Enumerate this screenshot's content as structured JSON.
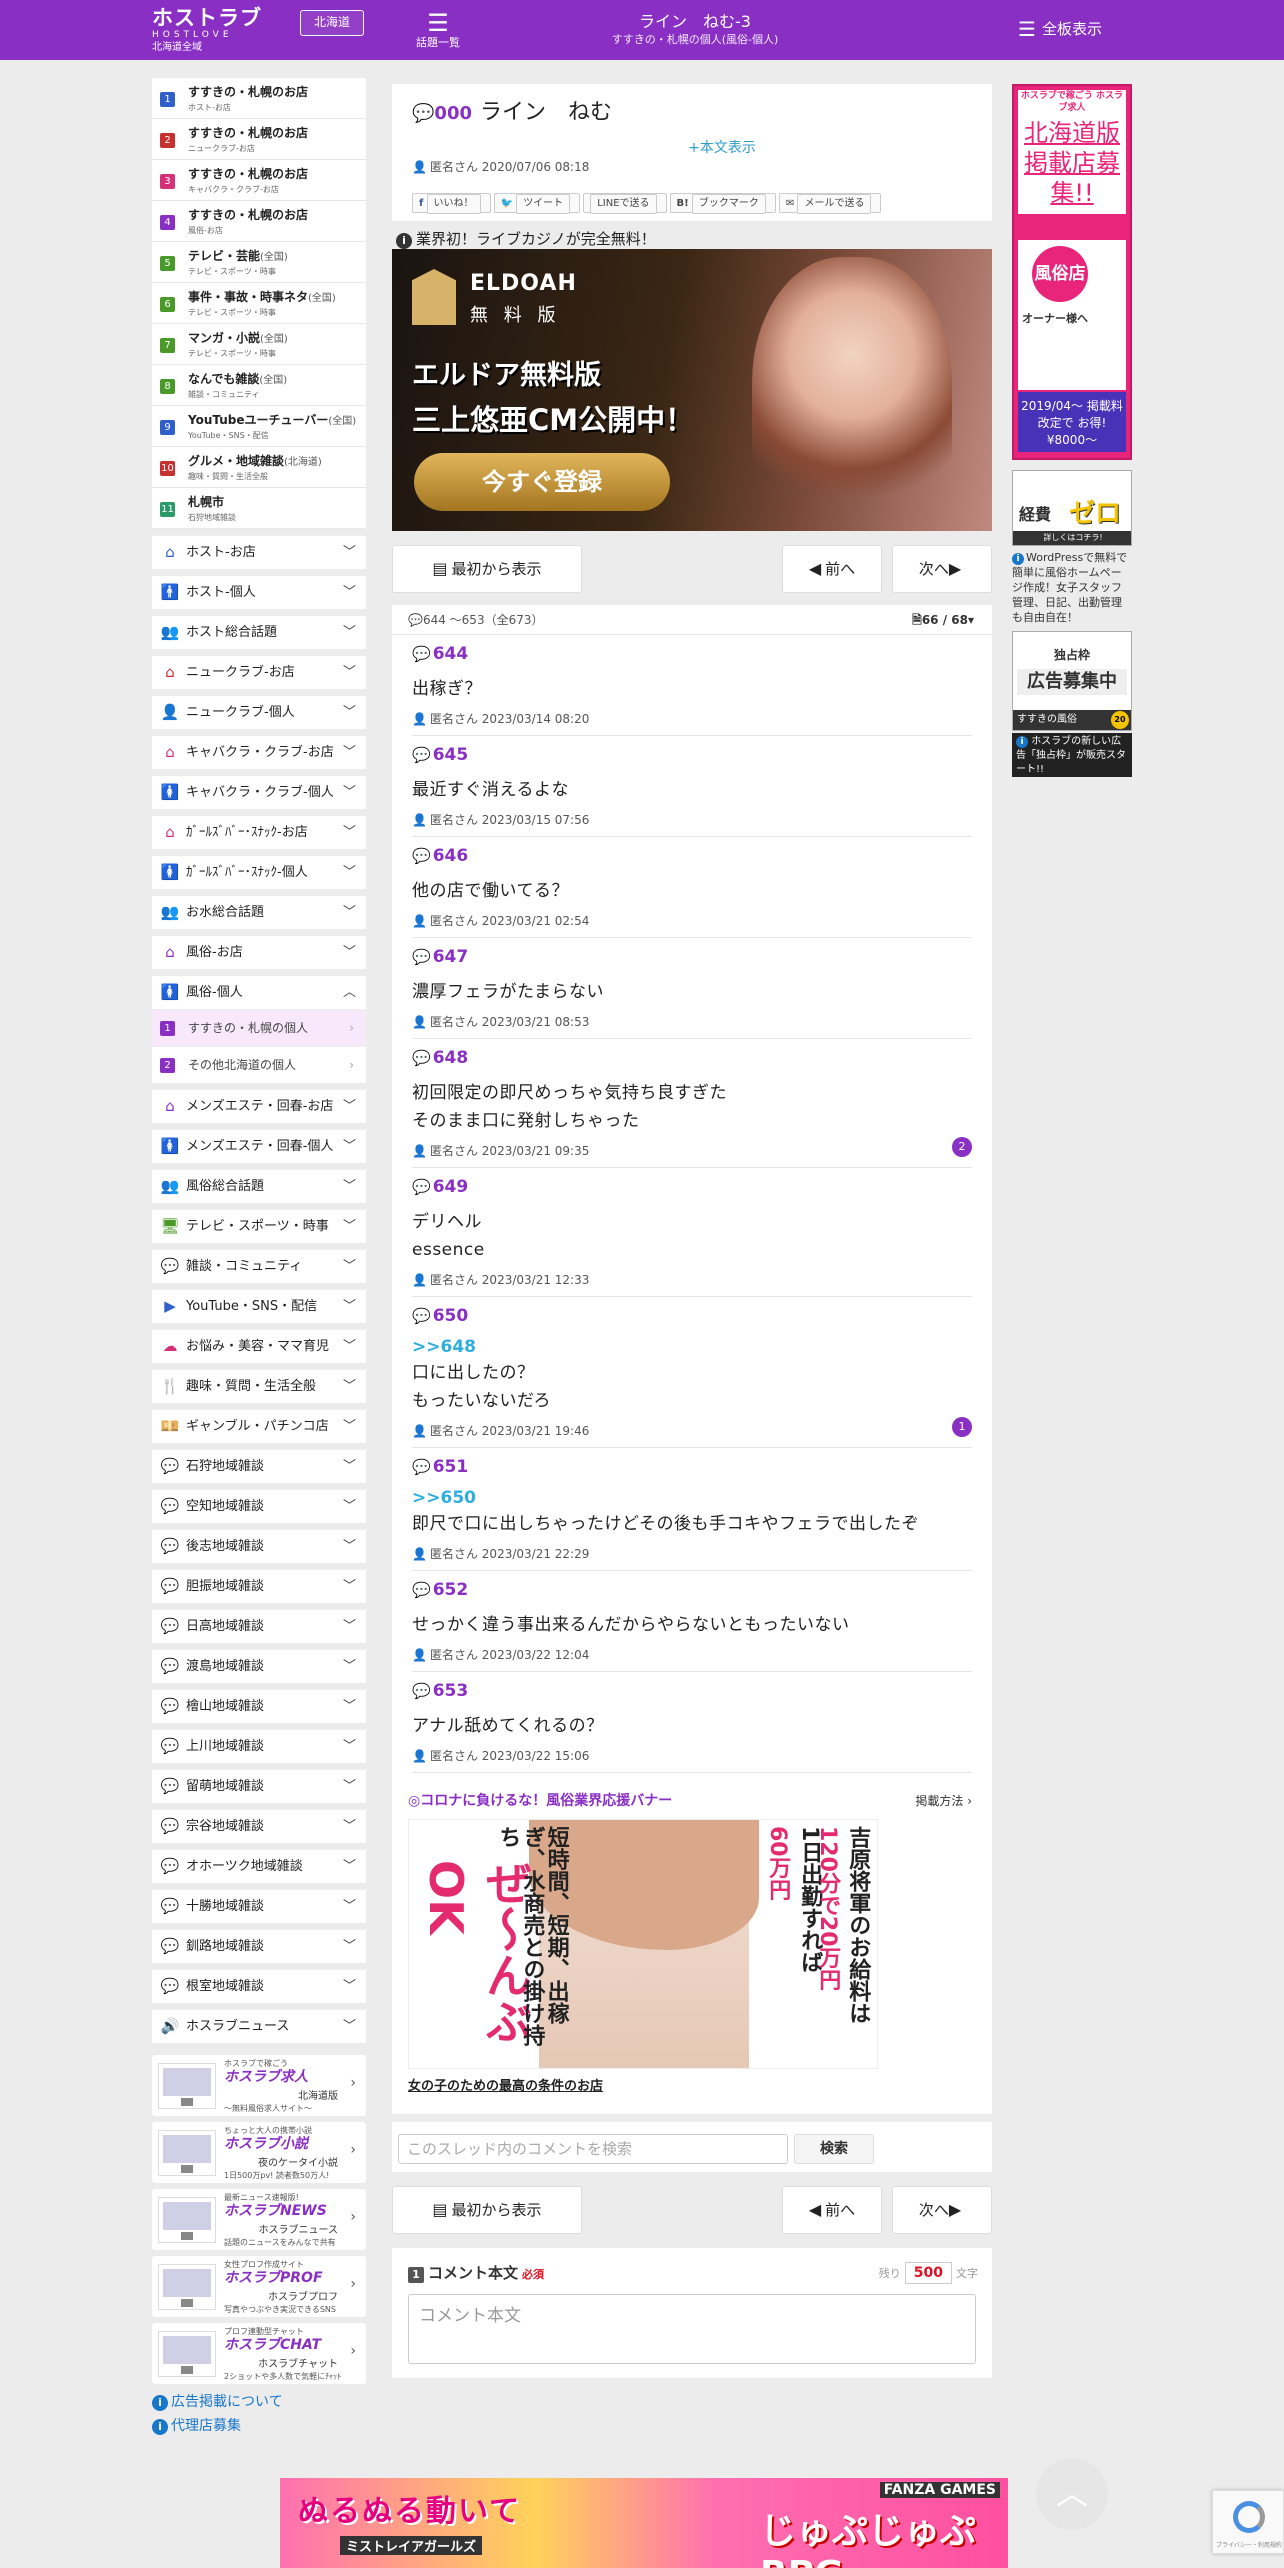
{
  "header": {
    "logo_main": "ホストラブ",
    "logo_sub": "HOSTLOVE",
    "logo_area": "北海道全域",
    "region_button": "北海道",
    "topics_icon": "list-numbered-icon",
    "topics_label": "話題一覧",
    "thread_title": "ライン　ねむ-3",
    "thread_category": "すすきの・札幌の個人(風俗-個人)",
    "menu_label": "全板表示",
    "menu_icon": "list-icon",
    "brand_color": "#8a2fc4"
  },
  "sidebar": {
    "sub_items": [
      {
        "num": "1",
        "name": "すすきの・札幌のお店",
        "extra": "",
        "desc": "ホスト-お店",
        "color": "#2f5fc8"
      },
      {
        "num": "2",
        "name": "すすきの・札幌のお店",
        "extra": "",
        "desc": "ニュークラブ-お店",
        "color": "#c8302f"
      },
      {
        "num": "3",
        "name": "すすきの・札幌のお店",
        "extra": "",
        "desc": "キャバクラ・クラブ-お店",
        "color": "#d6307a"
      },
      {
        "num": "4",
        "name": "すすきの・札幌のお店",
        "extra": "",
        "desc": "風俗-お店",
        "color": "#8a2fc4"
      },
      {
        "num": "5",
        "name": "テレビ・芸能",
        "extra": "(全国)",
        "desc": "テレビ・スポーツ・時事",
        "color": "#4a9a2a"
      },
      {
        "num": "6",
        "name": "事件・事故・時事ネタ",
        "extra": "(全国)",
        "desc": "テレビ・スポーツ・時事",
        "color": "#4a9a2a"
      },
      {
        "num": "7",
        "name": "マンガ・小説",
        "extra": "(全国)",
        "desc": "テレビ・スポーツ・時事",
        "color": "#4a9a2a"
      },
      {
        "num": "8",
        "name": "なんでも雑談",
        "extra": "(全国)",
        "desc": "雑談・コミュニティ",
        "color": "#4a9a2a"
      },
      {
        "num": "9",
        "name": "YouTubeユーチューバー",
        "extra": "(全国)",
        "desc": "YouTube・SNS・配信",
        "color": "#2f5fc8"
      },
      {
        "num": "10",
        "name": "グルメ・地域雑談",
        "extra": "(北海道)",
        "desc": "趣味・質問・生活全般",
        "color": "#c8302f"
      },
      {
        "num": "11",
        "name": "札幌市",
        "extra": "",
        "desc": "石狩地域雑談",
        "color": "#2b9a6a"
      }
    ],
    "categories_a": [
      {
        "name": "ホスト-お店",
        "icon": "home-icon",
        "glyph": "⌂",
        "color": "#2f5fc8"
      },
      {
        "name": "ホスト-個人",
        "icon": "person-icon",
        "glyph": "🚹",
        "color": "#2f5fc8"
      },
      {
        "name": "ホスト総合話題",
        "icon": "people-icon",
        "glyph": "👥",
        "color": "#2f5fc8"
      },
      {
        "name": "ニュークラブ-お店",
        "icon": "home-icon",
        "glyph": "⌂",
        "color": "#c8302f"
      },
      {
        "name": "ニュークラブ-個人",
        "icon": "person-icon",
        "glyph": "👤",
        "color": "#c8302f"
      },
      {
        "name": "キャバクラ・クラブ-お店",
        "icon": "home-icon",
        "glyph": "⌂",
        "color": "#d6307a"
      },
      {
        "name": "キャバクラ・クラブ-個人",
        "icon": "female-icon",
        "glyph": "🚺",
        "color": "#d6307a"
      },
      {
        "name": "ｶﾞｰﾙｽﾞﾊﾞｰ･ｽﾅｯｸ-お店",
        "icon": "home-icon",
        "glyph": "⌂",
        "color": "#d6307a"
      },
      {
        "name": "ｶﾞｰﾙｽﾞﾊﾞｰ･ｽﾅｯｸ-個人",
        "icon": "female-icon",
        "glyph": "🚺",
        "color": "#d6307a"
      },
      {
        "name": "お水総合話題",
        "icon": "people-icon",
        "glyph": "👥",
        "color": "#d6307a"
      },
      {
        "name": "風俗-お店",
        "icon": "home-icon",
        "glyph": "⌂",
        "color": "#8a2fc4"
      }
    ],
    "expanded_category": {
      "name": "風俗-個人",
      "icon": "female-icon",
      "glyph": "🚺",
      "color": "#8a2fc4"
    },
    "expanded_items": [
      {
        "num": "1",
        "name": "すすきの・札幌の個人"
      },
      {
        "num": "2",
        "name": "その他北海道の個人"
      }
    ],
    "categories_b": [
      {
        "name": "メンズエステ・回春-お店",
        "icon": "home-icon",
        "glyph": "⌂",
        "color": "#8a2fc4"
      },
      {
        "name": "メンズエステ・回春-個人",
        "icon": "female-icon",
        "glyph": "🚺",
        "color": "#8a2fc4"
      },
      {
        "name": "風俗総合話題",
        "icon": "people-icon",
        "glyph": "👥",
        "color": "#8a2fc4"
      },
      {
        "name": "テレビ・スポーツ・時事",
        "icon": "tv-icon",
        "glyph": "🖥",
        "color": "#4a9a2a"
      },
      {
        "name": "雑談・コミュニティ",
        "icon": "chat-icon",
        "glyph": "💬",
        "color": "#4a9a2a"
      },
      {
        "name": "YouTube・SNS・配信",
        "icon": "youtube-icon",
        "glyph": "▶",
        "color": "#2f5fc8"
      },
      {
        "name": "お悩み・美容・ママ育児",
        "icon": "cloud-icon",
        "glyph": "☁",
        "color": "#d6307a"
      },
      {
        "name": "趣味・質問・生活全般",
        "icon": "utensils-icon",
        "glyph": "🍴",
        "color": "#c8302f"
      },
      {
        "name": "ギャンブル・パチンコ店",
        "icon": "money-icon",
        "glyph": "💴",
        "color": "#c8302f"
      },
      {
        "name": "石狩地域雑談",
        "icon": "comments-icon",
        "glyph": "💬",
        "color": "#2b9a6a"
      },
      {
        "name": "空知地域雑談",
        "icon": "comments-icon",
        "glyph": "💬",
        "color": "#2b9a6a"
      },
      {
        "name": "後志地域雑談",
        "icon": "comments-icon",
        "glyph": "💬",
        "color": "#2b9a6a"
      },
      {
        "name": "胆振地域雑談",
        "icon": "comments-icon",
        "glyph": "💬",
        "color": "#2b9a6a"
      },
      {
        "name": "日高地域雑談",
        "icon": "comments-icon",
        "glyph": "💬",
        "color": "#2f5fc8"
      },
      {
        "name": "渡島地域雑談",
        "icon": "comments-icon",
        "glyph": "💬",
        "color": "#2f5fc8"
      },
      {
        "name": "檜山地域雑談",
        "icon": "comments-icon",
        "glyph": "💬",
        "color": "#2f5fc8"
      },
      {
        "name": "上川地域雑談",
        "icon": "comments-icon",
        "glyph": "💬",
        "color": "#c8702f"
      },
      {
        "name": "留萌地域雑談",
        "icon": "comments-icon",
        "glyph": "💬",
        "color": "#c8702f"
      },
      {
        "name": "宗谷地域雑談",
        "icon": "comments-icon",
        "glyph": "💬",
        "color": "#c8702f"
      },
      {
        "name": "オホーツク地域雑談",
        "icon": "comments-icon",
        "glyph": "💬",
        "color": "#c8302f"
      },
      {
        "name": "十勝地域雑談",
        "icon": "comments-icon",
        "glyph": "💬",
        "color": "#c8302f"
      },
      {
        "name": "釧路地域雑談",
        "icon": "comments-icon",
        "glyph": "💬",
        "color": "#c8302f"
      },
      {
        "name": "根室地域雑談",
        "icon": "comments-icon",
        "glyph": "💬",
        "color": "#c8302f"
      },
      {
        "name": "ホスラブニュース",
        "icon": "megaphone-icon",
        "glyph": "🔊",
        "color": "#333333"
      }
    ],
    "banners": [
      {
        "logo_small": "ホスラブで稼ごう",
        "logo": "ホスラブ求人",
        "title": "北海道版",
        "desc": "～無料風俗求人サイト～"
      },
      {
        "logo_small": "ちょっと大人の携帯小説",
        "logo": "ホスラブ小説",
        "title": "夜のケータイ小説",
        "desc": "1日500万pv! 読者数50万人!"
      },
      {
        "logo_small": "最新ニュース速報版!",
        "logo": "ホスラブNEWS",
        "title": "ホスラブニュース",
        "desc": "話題のニュースをみんなで共有"
      },
      {
        "logo_small": "女性プロフ作成サイト",
        "logo": "ホスラブPROF",
        "title": "ホスラブプロフ",
        "desc": "写真やつぶやき実況できるSNS"
      },
      {
        "logo_small": "プロフ連動型チャット",
        "logo": "ホスラブCHAT",
        "title": "ホスラブチャット",
        "desc": "2ショットや多人数で気軽にﾁｬｯﾄ"
      }
    ],
    "link_ad": "広告掲載について",
    "link_agency": "代理店募集"
  },
  "thread": {
    "number": "000",
    "title": "ライン　ねむ",
    "show_body": "+本文表示",
    "author": "匿名さん",
    "date": "2020/07/06 08:18",
    "share": {
      "fb": "いいね！",
      "tw": "ツイート",
      "line": "LINEで送る",
      "bookmark": "ブックマーク",
      "mail": "メールで送る"
    }
  },
  "notice": "業界初！ライブカジノが完全無料！",
  "ad1": {
    "brand": "ELDOAH",
    "free": "無 料 版",
    "headline1": "エルドア無料版",
    "headline2": "三上悠亜CM公開中！",
    "cta": "今すぐ登録"
  },
  "nav": {
    "first": "最初から表示",
    "prev": "前へ",
    "next": "次へ"
  },
  "comments_header": {
    "range": "644 ～653（全673）",
    "page": "66 / 68"
  },
  "comments": [
    {
      "no": "644",
      "ref": "",
      "text": "出稼ぎ？",
      "author": "匿名さん",
      "date": "2023/03/14 08:20",
      "replies": ""
    },
    {
      "no": "645",
      "ref": "",
      "text": "最近すぐ消えるよな",
      "author": "匿名さん",
      "date": "2023/03/15 07:56",
      "replies": ""
    },
    {
      "no": "646",
      "ref": "",
      "text": "他の店で働いてる？",
      "author": "匿名さん",
      "date": "2023/03/21 02:54",
      "replies": ""
    },
    {
      "no": "647",
      "ref": "",
      "text": "濃厚フェラがたまらない",
      "author": "匿名さん",
      "date": "2023/03/21 08:53",
      "replies": ""
    },
    {
      "no": "648",
      "ref": "",
      "text": "初回限定の即尺めっちゃ気持ち良すぎた\nそのまま口に発射しちゃった",
      "author": "匿名さん",
      "date": "2023/03/21 09:35",
      "replies": "2"
    },
    {
      "no": "649",
      "ref": "",
      "text": "デリヘル\nessence",
      "author": "匿名さん",
      "date": "2023/03/21 12:33",
      "replies": ""
    },
    {
      "no": "650",
      "ref": ">>648",
      "text": "口に出したの？\nもったいないだろ",
      "author": "匿名さん",
      "date": "2023/03/21 19:46",
      "replies": "1"
    },
    {
      "no": "651",
      "ref": ">>650",
      "text": "即尺で口に出しちゃったけどその後も手コキやフェラで出したぞ",
      "author": "匿名さん",
      "date": "2023/03/21 22:29",
      "replies": ""
    },
    {
      "no": "652",
      "ref": "",
      "text": "せっかく違う事出来るんだからやらないともったいない",
      "author": "匿名さん",
      "date": "2023/03/22 12:04",
      "replies": ""
    },
    {
      "no": "653",
      "ref": "",
      "text": "アナル舐めてくれるの？",
      "author": "匿名さん",
      "date": "2023/03/22 15:06",
      "replies": ""
    }
  ],
  "corona": {
    "title": "◎コロナに負けるな！風俗業界応援バナー",
    "how": "掲載方法",
    "ad_zen": "ぜ〜んぶOK",
    "ad_col1": "吉原将軍のお給料は",
    "ad_col2": "120分で20万円",
    "ad_col3": "1日出勤すれば",
    "ad_col4": "60万円",
    "ad_col5": "短時間、短期、出稼ぎ、水商売との掛け持ち",
    "link": "女の子のための最高の条件のお店"
  },
  "search": {
    "placeholder": "このスレッド内のコメントを検索",
    "button": "検索"
  },
  "form": {
    "num": "1",
    "label": "コメント本文",
    "required": "必須",
    "remaining_label": "残り",
    "remaining": "500",
    "unit": "文字",
    "placeholder": "コメント本文"
  },
  "right": {
    "ad1_top": "ホスラブで稼ごう ホスラブ求人",
    "ad1_big": "北海道版掲載店募集!!",
    "ad1_badge": "風俗店",
    "ad1_owner": "オーナー様へ",
    "ad1_bottom": "2019/04〜 掲載料改定で お得!¥8000〜",
    "ad2_k": "経費",
    "ad2_z": "ゼロ",
    "ad2_strip": "詳しくはコチラ!",
    "ad2_text": "WordPressで無料で簡単に風俗ホームページ作成！女子スタッフ管理、日記、出勤管理も自由自在！",
    "ad3_head": "独占枠",
    "ad3_big": "広告募集中",
    "ad3_strip": "すすきの風俗",
    "ad3_badge": "20枠",
    "note": "ホスラブの新しい広告「独占枠」が販売スタート!!"
  },
  "bottom_ad": {
    "t1": "ぬるぬる動いて",
    "t2": "ミストレイアガールズ",
    "t3": "じゅぷじゅぷRPG",
    "brand": "FANZA GAMES"
  },
  "recaptcha": "プライバシー・利用規約"
}
